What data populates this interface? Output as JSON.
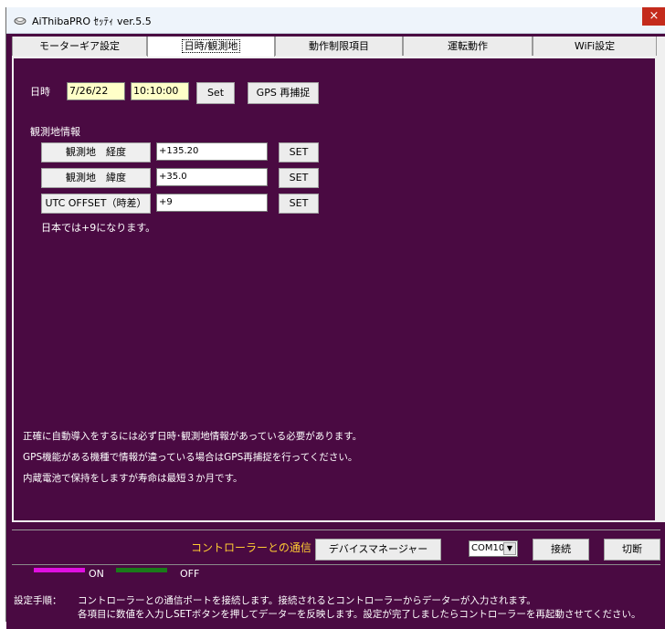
{
  "window": {
    "title": "AiThibaPRO ｾｯﾃｨ ver.5.5",
    "close_glyph": "×"
  },
  "tabs": [
    {
      "label": "モーターギア設定",
      "active": false
    },
    {
      "label": "日時/観測地",
      "active": true
    },
    {
      "label": "動作制限項目",
      "active": false
    },
    {
      "label": "運転動作",
      "active": false
    },
    {
      "label": "WiFi設定",
      "active": false
    }
  ],
  "datetime": {
    "label": "日時",
    "date_value": "7/26/22",
    "time_value": "10:10:00",
    "set_button": "Set",
    "gps_button": "GPS 再捕捉"
  },
  "observation": {
    "section_label": "観測地情報",
    "rows": [
      {
        "label": "観測地　経度",
        "value": "+135.20",
        "set": "SET"
      },
      {
        "label": "観測地　緯度",
        "value": "+35.0",
        "set": "SET"
      },
      {
        "label": "UTC OFFSET（時差）",
        "value": "+9",
        "set": "SET"
      }
    ],
    "note": "日本では+9になります。"
  },
  "notes": [
    "正確に自動導入をするには必ず日時･観測地情報があっている必要があります。",
    "GPS機能がある機種で情報が違っている場合はGPS再捕捉を行ってください。",
    "内蔵電池で保持をしますが寿命は最短３か月です。"
  ],
  "communication": {
    "label": "コントローラーとの通信",
    "device_manager_button": "デバイスマネージャー",
    "port_value": "COM10",
    "connect_button": "接続",
    "disconnect_button": "切断"
  },
  "legend": {
    "on_label": "ON",
    "off_label": "OFF",
    "on_color": "#e010e0",
    "off_color": "#1a7a1a"
  },
  "instructions": {
    "prefix": "設定手順：",
    "line1": "コントローラーとの通信ポートを接続します。接続されるとコントローラーからデーターが入力されます。",
    "line2": "各項目に数値を入力しSETボタンを押してデーターを反映します。設定が完了しましたらコントローラーを再起動させてください。"
  },
  "colors": {
    "background": "#4a0a42",
    "input_yellow": "#ffffc8",
    "comm_label": "#ffcc33"
  }
}
